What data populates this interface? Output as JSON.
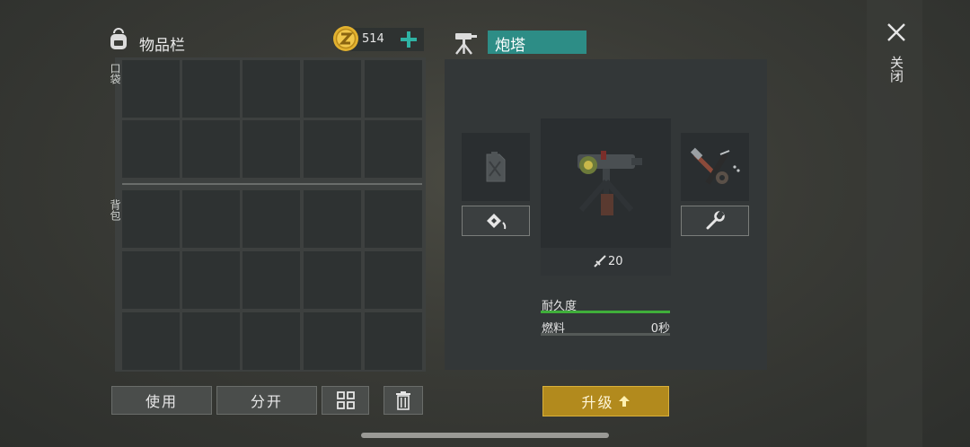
{
  "inventory": {
    "title": "物品栏",
    "coins": "514",
    "pocket_label": "口袋",
    "backpack_label": "背包"
  },
  "object": {
    "name": "炮塔",
    "damage": "20",
    "durability_label": "耐久度",
    "fuel_label": "燃料",
    "fuel_value": "0秒",
    "durability_fraction": 1.0,
    "fuel_fraction": 0.0
  },
  "buttons": {
    "use": "使用",
    "split": "分开",
    "upgrade": "升级"
  },
  "close_label": "关闭",
  "colors": {
    "accent_teal": "#2d8d86",
    "upgrade_gold": "#b28a1d",
    "durability_green": "#3fae3a"
  }
}
